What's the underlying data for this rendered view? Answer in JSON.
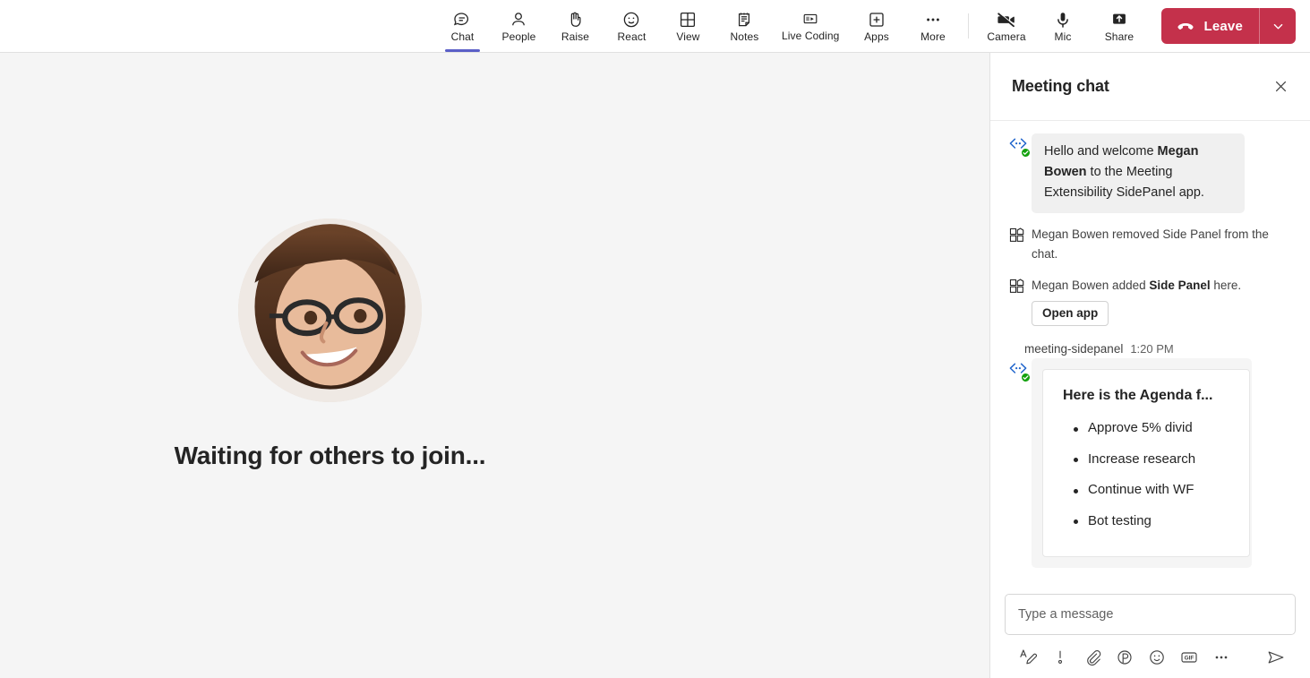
{
  "toolbar": {
    "items": [
      {
        "label": "Chat",
        "icon": "chat-icon",
        "active": true
      },
      {
        "label": "People",
        "icon": "people-icon",
        "active": false
      },
      {
        "label": "Raise",
        "icon": "raise-hand-icon",
        "active": false
      },
      {
        "label": "React",
        "icon": "react-smiley-icon",
        "active": false
      },
      {
        "label": "View",
        "icon": "view-grid-icon",
        "active": false
      },
      {
        "label": "Notes",
        "icon": "notes-icon",
        "active": false
      },
      {
        "label": "Live Coding",
        "icon": "live-coding-icon",
        "active": false
      },
      {
        "label": "Apps",
        "icon": "apps-plus-icon",
        "active": false
      },
      {
        "label": "More",
        "icon": "more-ellipsis-icon",
        "active": false
      }
    ],
    "device_items": [
      {
        "label": "Camera",
        "icon": "camera-off-icon"
      },
      {
        "label": "Mic",
        "icon": "microphone-icon"
      },
      {
        "label": "Share",
        "icon": "share-up-arrow-icon"
      }
    ],
    "leave": {
      "label": "Leave",
      "icon": "hangup-phone-icon",
      "caret_icon": "chevron-down-icon",
      "color": "#C4314B"
    },
    "active_indicator_color": "#5B5FC7"
  },
  "stage": {
    "caption": "Waiting for others to join...",
    "avatar_name": "participant-avatar",
    "background": "#F5F5F5"
  },
  "chat": {
    "title": "Meeting chat",
    "close_icon": "close-icon",
    "messages": [
      {
        "kind": "bot-bubble",
        "icon": "bot-app-icon",
        "badge": "verified-check-badge",
        "text_parts": [
          {
            "t": "Hello and welcome ",
            "b": false
          },
          {
            "t": "Megan Bowen",
            "b": true
          },
          {
            "t": " to the Meeting Extensibility SidePanel app.",
            "b": false
          }
        ]
      },
      {
        "kind": "system",
        "icon": "apps-package-icon",
        "text_parts": [
          {
            "t": "Megan Bowen removed Side Panel from the chat.",
            "b": false
          }
        ]
      },
      {
        "kind": "system-with-button",
        "icon": "apps-package-icon",
        "text_parts": [
          {
            "t": "Megan Bowen added ",
            "b": false
          },
          {
            "t": "Side Panel",
            "b": true
          },
          {
            "t": " here.",
            "b": false
          }
        ],
        "button_label": "Open app"
      }
    ],
    "card_message": {
      "sender": "meeting-sidepanel",
      "time": "1:20 PM",
      "icon": "bot-app-icon",
      "badge": "verified-check-badge",
      "card": {
        "title": "Here is the Agenda f...",
        "items": [
          "Approve 5% divid",
          "Increase research",
          "Continue with WF",
          "Bot testing"
        ]
      }
    },
    "compose": {
      "placeholder": "Type a message",
      "value": "",
      "tools": [
        {
          "icon": "format-text-icon"
        },
        {
          "icon": "importance-icon"
        },
        {
          "icon": "attach-paperclip-icon"
        },
        {
          "icon": "loop-component-icon"
        },
        {
          "icon": "emoji-icon"
        },
        {
          "icon": "gif-icon"
        },
        {
          "icon": "more-options-icon"
        }
      ],
      "send_icon": "send-arrow-icon"
    }
  }
}
